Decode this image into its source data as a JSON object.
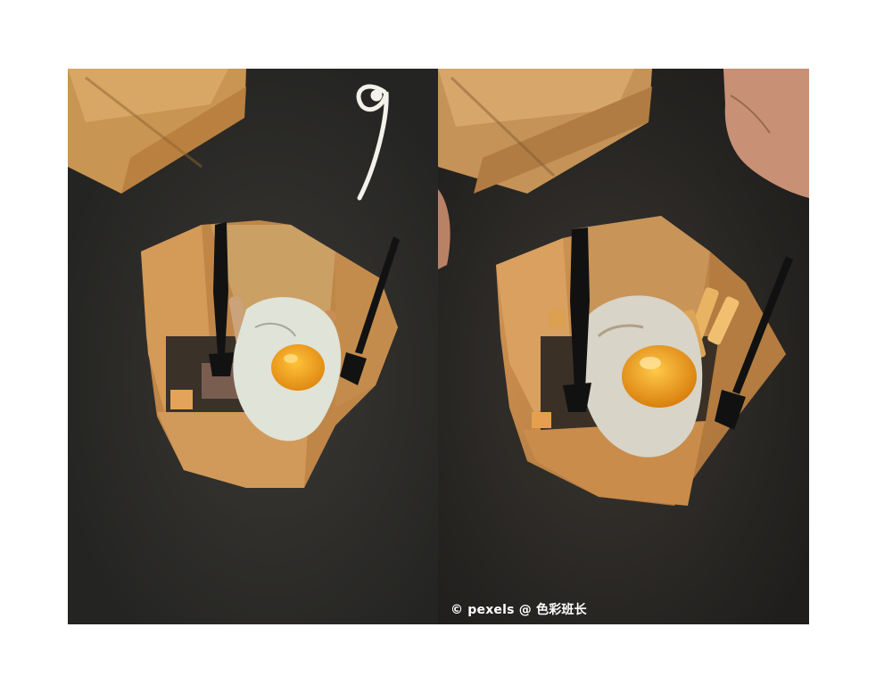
{
  "credit": {
    "text": "© pexels @ 色彩班长"
  },
  "left_panel": {
    "handwritten_mark": "9"
  },
  "colors": {
    "background": "#ffffff",
    "table_dark": "#2c2c2a",
    "kraft_box": "#c9914a",
    "egg_yolk": "#f0a020",
    "egg_white": "#dfe3d8"
  }
}
